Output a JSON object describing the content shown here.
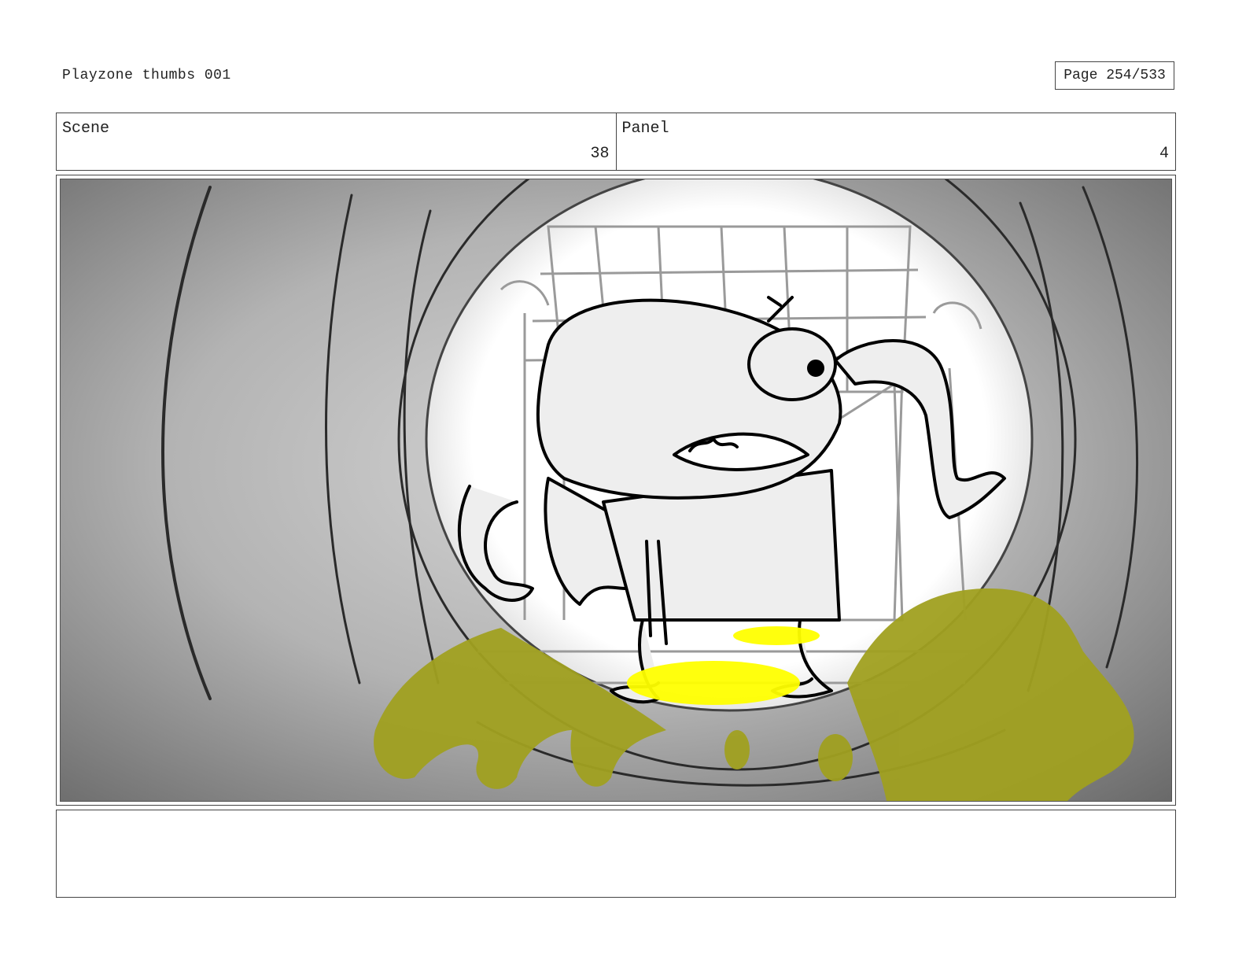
{
  "document": {
    "title": "Playzone thumbs 001",
    "page_label": "Page 254/533"
  },
  "scene": {
    "label": "Scene",
    "value": "38"
  },
  "panel": {
    "label": "Panel",
    "value": "4"
  },
  "artwork": {
    "glow_color": "#ffff00",
    "goo_color": "#a0a020"
  },
  "notes": {
    "text": ""
  }
}
